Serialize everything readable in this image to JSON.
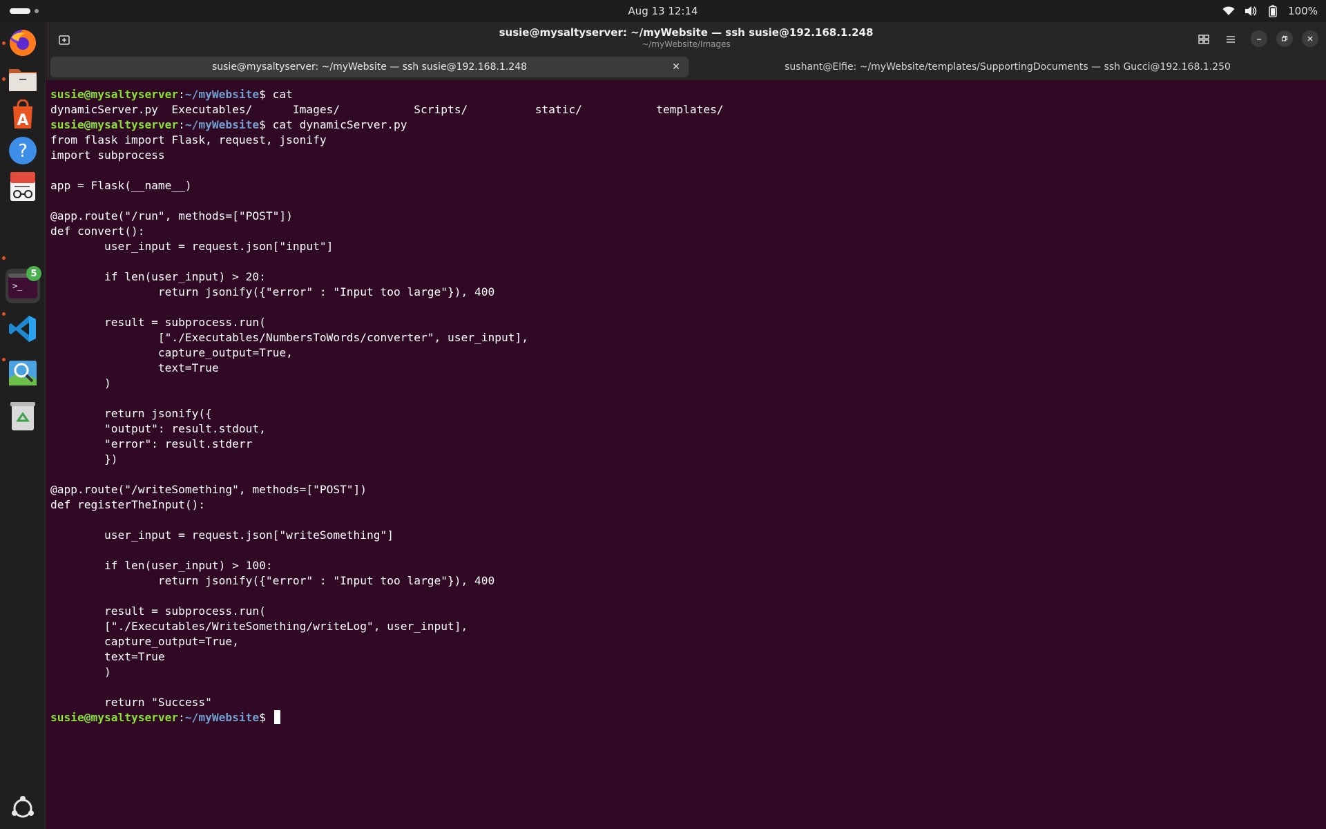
{
  "topbar": {
    "clock": "Aug 13  12:14",
    "battery": "100%",
    "icons": [
      "wifi-icon",
      "volume-icon",
      "battery-icon"
    ]
  },
  "dock": {
    "items": [
      {
        "name": "firefox",
        "icon": "firefox-icon",
        "running": true
      },
      {
        "name": "files",
        "icon": "files-icon",
        "running": true
      },
      {
        "name": "app-center",
        "icon": "app-center-icon",
        "running": false
      },
      {
        "name": "help",
        "icon": "help-icon",
        "running": false
      },
      {
        "name": "document-viewer",
        "icon": "document-viewer-icon",
        "running": false
      },
      {
        "name": "terminal",
        "icon": "terminal-icon",
        "running": true,
        "badge": "5"
      },
      {
        "name": "vscode",
        "icon": "vscode-icon",
        "running": true
      },
      {
        "name": "image-viewer",
        "icon": "image-viewer-icon",
        "running": true
      },
      {
        "name": "trash",
        "icon": "trash-icon",
        "running": false
      }
    ],
    "show_apps_icon": "ubuntu-icon"
  },
  "window": {
    "title": "susie@mysaltyserver: ~/myWebsite — ssh susie@192.168.1.248",
    "subtitle": "~/myWebsite/Images",
    "tabs": [
      {
        "label": "susie@mysaltyserver: ~/myWebsite — ssh susie@192.168.1.248",
        "active": true
      },
      {
        "label": "sushant@Elfie: ~/myWebsite/templates/SupportingDocuments — ssh Gucci@192.168.1.250",
        "active": false
      }
    ],
    "close_tab_label": "✕"
  },
  "terminal": {
    "prompt_user": "susie@mysaltyserver",
    "prompt_path": "~/myWebsite",
    "lines": [
      {
        "prompt": true,
        "cmd": " cat"
      },
      {
        "text": "dynamicServer.py  Executables/      Images/           Scripts/          static/           templates/"
      },
      {
        "prompt": true,
        "cmd": " cat dynamicServer.py"
      },
      {
        "text": "from flask import Flask, request, jsonify"
      },
      {
        "text": "import subprocess"
      },
      {
        "text": ""
      },
      {
        "text": "app = Flask(__name__)"
      },
      {
        "text": ""
      },
      {
        "text": "@app.route(\"/run\", methods=[\"POST\"])"
      },
      {
        "text": "def convert():"
      },
      {
        "text": "        user_input = request.json[\"input\"]"
      },
      {
        "text": ""
      },
      {
        "text": "        if len(user_input) > 20:"
      },
      {
        "text": "                return jsonify({\"error\" : \"Input too large\"}), 400"
      },
      {
        "text": ""
      },
      {
        "text": "        result = subprocess.run("
      },
      {
        "text": "                [\"./Executables/NumbersToWords/converter\", user_input],"
      },
      {
        "text": "                capture_output=True,"
      },
      {
        "text": "                text=True"
      },
      {
        "text": "        )"
      },
      {
        "text": ""
      },
      {
        "text": "        return jsonify({"
      },
      {
        "text": "        \"output\": result.stdout,"
      },
      {
        "text": "        \"error\": result.stderr"
      },
      {
        "text": "        })"
      },
      {
        "text": ""
      },
      {
        "text": "@app.route(\"/writeSomething\", methods=[\"POST\"])"
      },
      {
        "text": "def registerTheInput():"
      },
      {
        "text": ""
      },
      {
        "text": "        user_input = request.json[\"writeSomething\"]"
      },
      {
        "text": ""
      },
      {
        "text": "        if len(user_input) > 100:"
      },
      {
        "text": "                return jsonify({\"error\" : \"Input too large\"}), 400"
      },
      {
        "text": ""
      },
      {
        "text": "        result = subprocess.run("
      },
      {
        "text": "        [\"./Executables/WriteSomething/writeLog\", user_input],"
      },
      {
        "text": "        capture_output=True,"
      },
      {
        "text": "        text=True"
      },
      {
        "text": "        )"
      },
      {
        "text": ""
      },
      {
        "text": "        return \"Success\""
      },
      {
        "prompt": true,
        "cmd": " ",
        "cursor": true
      }
    ]
  },
  "colors": {
    "terminal_bg": "#300a24",
    "prompt_user": "#8ae234",
    "prompt_path": "#729fcf",
    "accent": "#e95420"
  }
}
